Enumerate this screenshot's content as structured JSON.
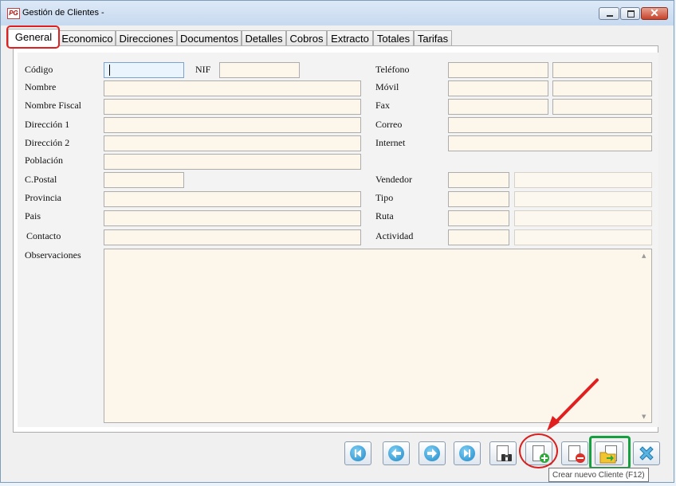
{
  "window": {
    "title": "Gestión de Clientes -",
    "app_logo_text": "PG",
    "close_glyph": "✕"
  },
  "tabs": [
    "General",
    "Economico",
    "Direcciones",
    "Documentos",
    "Detalles",
    "Cobros",
    "Extracto",
    "Totales",
    "Tarifas"
  ],
  "active_tab": "General",
  "form": {
    "left_labels": {
      "codigo": "Código",
      "nif": "NIF",
      "nombre": "Nombre",
      "nombre_fiscal": "Nombre Fiscal",
      "direccion1": "Dirección 1",
      "direccion2": "Dirección 2",
      "poblacion": "Población",
      "cpostal": "C.Postal",
      "provincia": "Provincia",
      "pais": "Pais",
      "contacto": "Contacto",
      "observaciones": "Observaciones"
    },
    "right_labels": {
      "telefono": "Teléfono",
      "movil": "Móvil",
      "fax": "Fax",
      "correo": "Correo",
      "internet": "Internet",
      "vendedor": "Vendedor",
      "tipo": "Tipo",
      "ruta": "Ruta",
      "actividad": "Actividad"
    },
    "values": {
      "codigo": "",
      "nif": "",
      "nombre": "",
      "nombre_fiscal": "",
      "direccion1": "",
      "direccion2": "",
      "poblacion": "",
      "cpostal": "",
      "provincia": "",
      "pais": "",
      "contacto": "",
      "observaciones": "",
      "telefono1": "",
      "telefono2": "",
      "movil1": "",
      "movil2": "",
      "fax1": "",
      "fax2": "",
      "correo": "",
      "internet": "",
      "vendedor_code": "",
      "vendedor_name": "",
      "tipo_code": "",
      "tipo_name": "",
      "ruta_code": "",
      "ruta_name": "",
      "actividad_code": "",
      "actividad_name": ""
    }
  },
  "toolbar": {
    "buttons": [
      "first-record",
      "previous-record",
      "next-record",
      "last-record",
      "search",
      "new-client",
      "delete-client",
      "save-client",
      "exit"
    ],
    "tooltip": "Crear nuevo Cliente (F12)"
  },
  "colors": {
    "field_bg": "#fdf6ea",
    "annotation_red": "#e02020",
    "annotation_green": "#14a040",
    "nav_blue": "#1e88c8"
  }
}
